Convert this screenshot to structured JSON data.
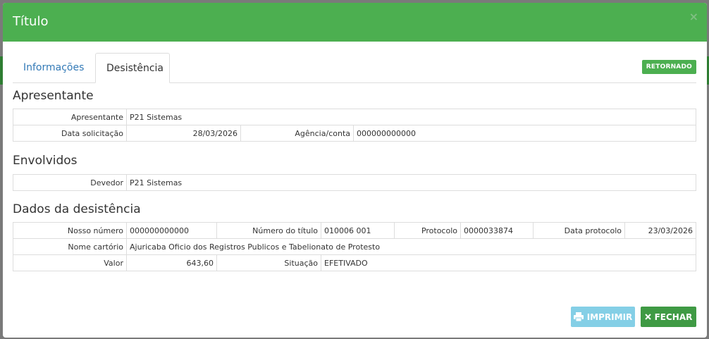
{
  "modal": {
    "title": "Título",
    "close_glyph": "×"
  },
  "tabs": [
    {
      "label": "Informações"
    },
    {
      "label": "Desistência"
    }
  ],
  "status_badge": "RETORNADO",
  "apresentante": {
    "section_title": "Apresentante",
    "apresentante_label": "Apresentante",
    "apresentante_value": "P21 Sistemas",
    "data_solicitacao_label": "Data solicitação",
    "data_solicitacao_value": "28/03/2026",
    "agencia_label": "Agência/conta",
    "agencia_value": "000000000000"
  },
  "envolvidos": {
    "section_title": "Envolvidos",
    "devedor_label": "Devedor",
    "devedor_value": "P21 Sistemas"
  },
  "desistencia": {
    "section_title": "Dados da desistência",
    "nosso_numero_label": "Nosso número",
    "nosso_numero_value": "000000000000",
    "numero_titulo_label": "Número do título",
    "numero_titulo_value": "010006 001",
    "protocolo_label": "Protocolo",
    "protocolo_value": "0000033874",
    "data_protocolo_label": "Data protocolo",
    "data_protocolo_value": "23/03/2026",
    "nome_cartorio_label": "Nome cartório",
    "nome_cartorio_value": "Ajuricaba Oficio dos Registros Publicos e Tabelionato de Protesto",
    "valor_label": "Valor",
    "valor_value": "643,60",
    "situacao_label": "Situação",
    "situacao_value": "EFETIVADO"
  },
  "footer": {
    "print_label": "IMPRIMIR",
    "close_label": "FECHAR"
  },
  "colors": {
    "header": "#4caf50",
    "badge": "#4caf50",
    "print_button": "#5bc0de",
    "close_button": "#3f9a44",
    "tab_link": "#337ab7"
  },
  "icons": {
    "print": "printer-icon",
    "close": "times-icon"
  }
}
